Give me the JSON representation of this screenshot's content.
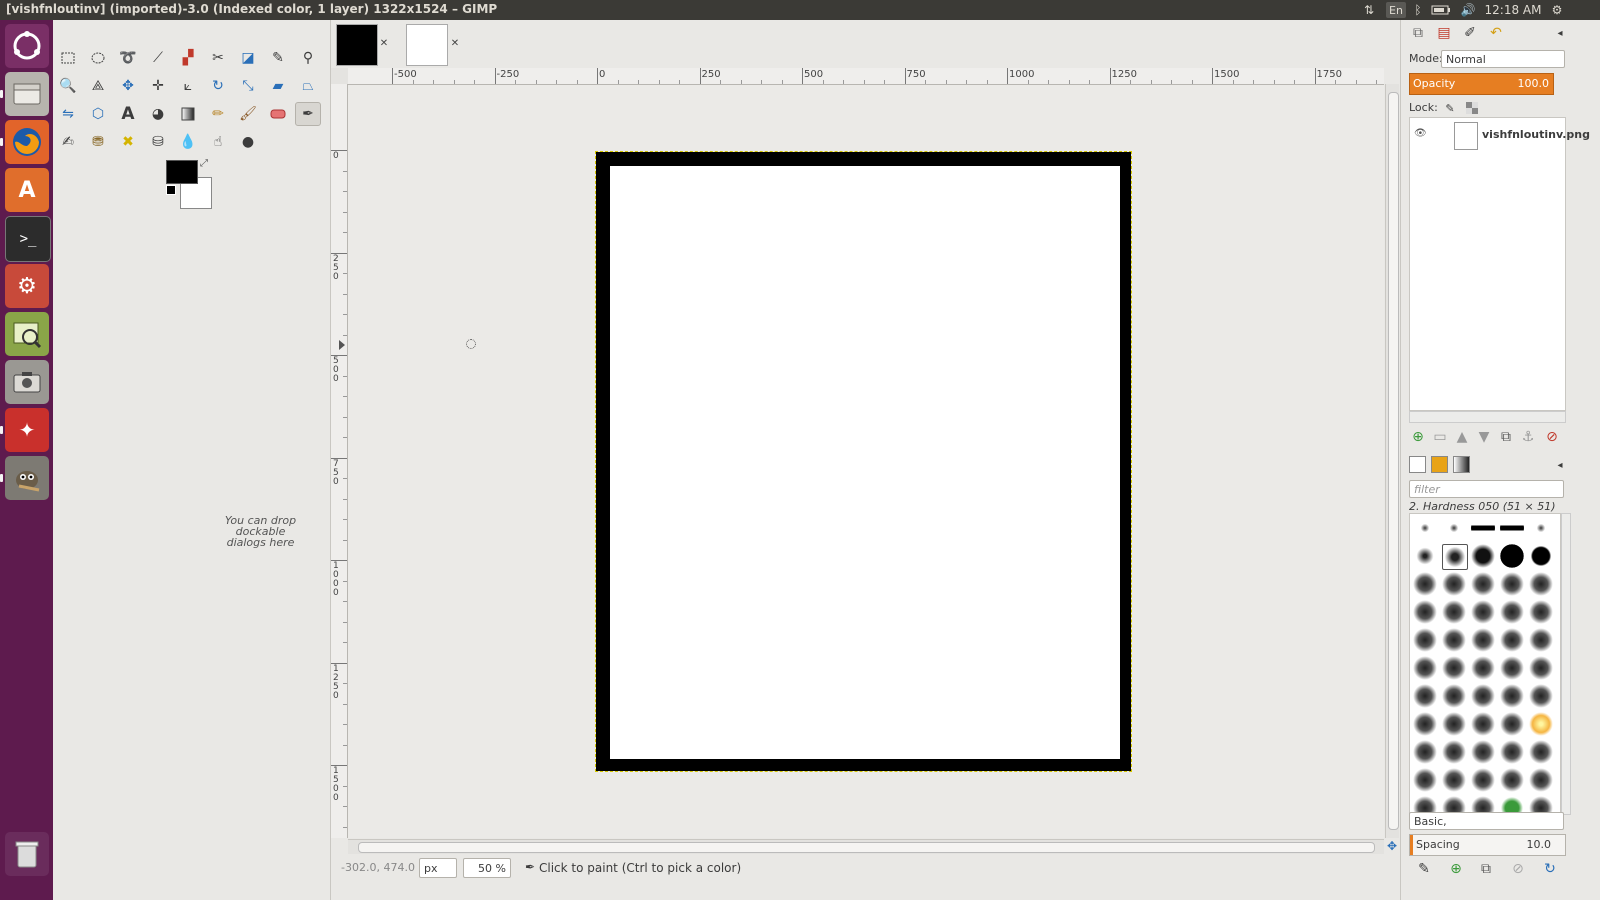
{
  "window_title": "[vishfnloutinv] (imported)-3.0 (Indexed color, 1 layer) 1322x1524 – GIMP",
  "top_panel": {
    "keyboard": "En",
    "time": "12:18 AM"
  },
  "launcher_items": [
    "dash-home",
    "files",
    "firefox",
    "software-center",
    "terminal",
    "system-settings",
    "image-viewer",
    "screenshot",
    "app-red",
    "gimp"
  ],
  "toolbox": {
    "drop_hint": "You can drop dockable dialogs here"
  },
  "rulers": {
    "horizontal": [
      "-500",
      "-250",
      "0",
      "250",
      "500",
      "750",
      "1000",
      "1250",
      "1500",
      "1750"
    ],
    "vertical": [
      "0",
      "250",
      "500",
      "750",
      "1000",
      "1250",
      "1500"
    ]
  },
  "status_bar": {
    "coords": "-302.0, 474.0",
    "unit": "px",
    "zoom": "50 %",
    "message": "Click to paint (Ctrl to pick a color)"
  },
  "layers_panel": {
    "mode_label": "Mode:",
    "mode_value": "Normal",
    "opacity_label": "Opacity",
    "opacity_value": "100.0",
    "lock_label": "Lock:",
    "layer_name": "vishfnloutinv.png"
  },
  "brushes_panel": {
    "filter_placeholder": "filter",
    "selected_brush": "2. Hardness 050 (51 × 51)",
    "tag_value": "Basic,",
    "spacing_label": "Spacing",
    "spacing_value": "10.0"
  },
  "colors": {
    "launcher_bg": "#5e1b4e",
    "top_panel_bg": "#3b3a36",
    "opacity_bar": "#e67e22",
    "foreground": "#000000",
    "background": "#ffffff"
  }
}
